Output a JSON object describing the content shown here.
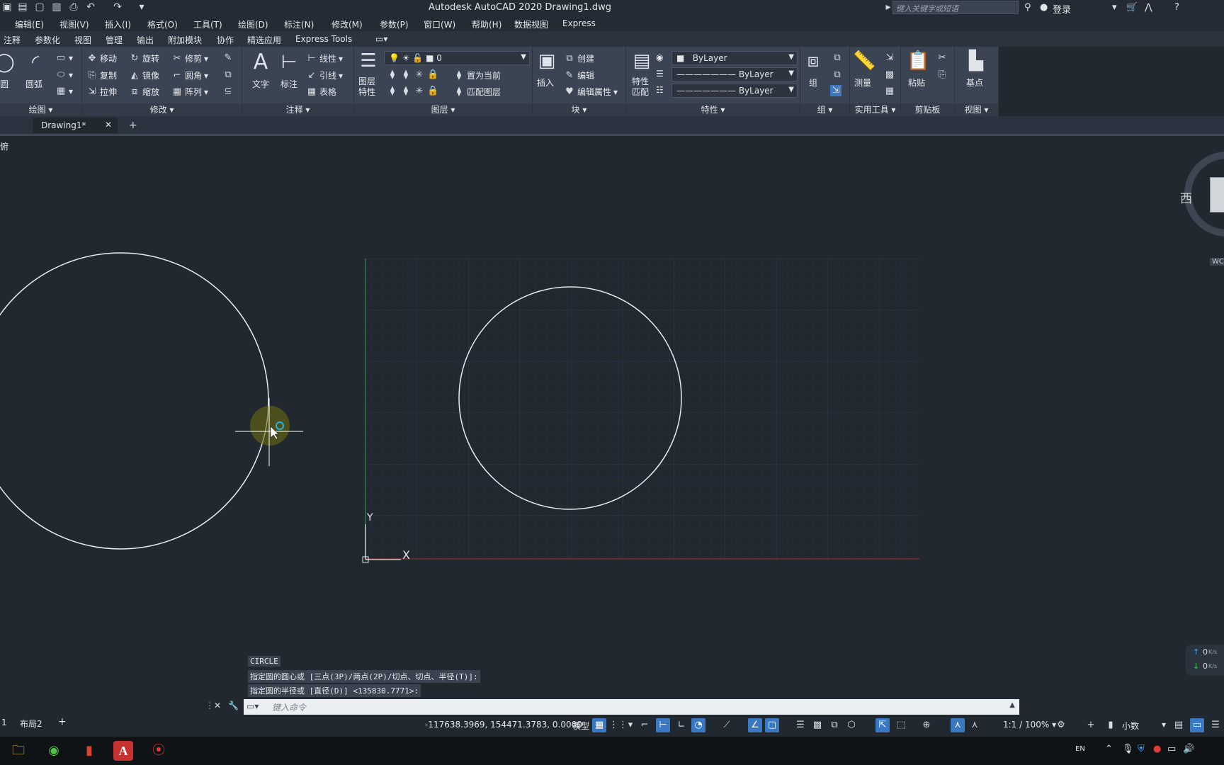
{
  "titlebar": {
    "title": "Autodesk AutoCAD 2020    Drawing1.dwg",
    "search_placeholder": "键入关键字或短语",
    "login": "登录"
  },
  "menubar": {
    "items": [
      "编辑(E)",
      "视图(V)",
      "插入(I)",
      "格式(O)",
      "工具(T)",
      "绘图(D)",
      "标注(N)",
      "修改(M)",
      "参数(P)",
      "窗口(W)",
      "帮助(H)",
      "数据视图",
      "Express"
    ]
  },
  "ribbon_tabs": {
    "items": [
      "注释",
      "参数化",
      "视图",
      "管理",
      "输出",
      "附加模块",
      "协作",
      "精选应用",
      "Express Tools"
    ]
  },
  "ribbon": {
    "draw": {
      "circle": "圆",
      "arc": "圆弧",
      "footer": "绘图"
    },
    "modify": {
      "move": "移动",
      "rotate": "旋转",
      "trim": "修剪",
      "copy": "复制",
      "mirror": "镜像",
      "fillet": "圆角",
      "stretch": "拉伸",
      "scale": "缩放",
      "array": "阵列",
      "footer": "修改"
    },
    "annotation": {
      "text": "文字",
      "dimension": "标注",
      "linear": "线性",
      "leader": "引线",
      "table": "表格",
      "footer": "注释"
    },
    "layers": {
      "layer_props": "图层\n特性",
      "layer_name": "0",
      "set_current": "置为当前",
      "match_layer": "匹配图层",
      "footer": "图层"
    },
    "block": {
      "insert": "插入",
      "create": "创建",
      "edit": "编辑",
      "edit_attr": "编辑属性",
      "footer": "块"
    },
    "properties": {
      "match": "特性\n匹配",
      "color": "ByLayer",
      "linetype": "ByLayer",
      "lineweight": "ByLayer",
      "footer": "特性"
    },
    "groups": {
      "group": "组",
      "footer": "组"
    },
    "utilities": {
      "measure": "测量",
      "footer": "实用工具"
    },
    "clipboard": {
      "paste": "粘贴",
      "footer": "剪贴板"
    },
    "view": {
      "base": "基点",
      "footer": "视图"
    }
  },
  "doc_tabs": {
    "active": "Drawing1*"
  },
  "viewport": {
    "label": "俯",
    "viewcube_west": "西",
    "wcs": "WC"
  },
  "ucs": {
    "y": "Y",
    "x": "X"
  },
  "command": {
    "history": [
      "CIRCLE",
      "指定圆的圆心或 [三点(3P)/两点(2P)/切点、切点、半径(T)]:",
      "指定圆的半径或 [直径(D)] <135830.7771>:"
    ],
    "placeholder": "键入命令"
  },
  "layout_tabs": [
    "1",
    "布局2"
  ],
  "statusbar": {
    "coords": "-117638.3969, 154471.3783, 0.0000",
    "model": "模型",
    "scale": "1:1 / 100%",
    "units": "小数"
  },
  "netspeed": {
    "up": "0",
    "down": "0",
    "unit": "K/s"
  },
  "taskbar": {
    "lang": "EN"
  }
}
